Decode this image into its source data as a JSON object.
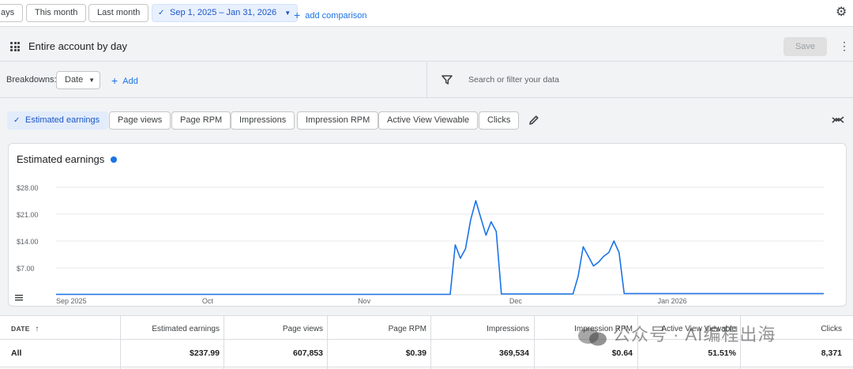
{
  "topbar": {
    "date_chips": [
      "ays",
      "This month",
      "Last month"
    ],
    "range_label": "Sep 1, 2025 – Jan 31, 2026",
    "add_comparison": "add comparison"
  },
  "header": {
    "title": "Entire account by day",
    "save_label": "Save"
  },
  "breakdowns": {
    "label": "Breakdowns:",
    "selected": "Date",
    "add_label": "Add",
    "search_placeholder": "Search or filter your data"
  },
  "metrics": [
    "Estimated earnings",
    "Page views",
    "Page RPM",
    "Impressions",
    "Impression RPM",
    "Active View Viewable",
    "Clicks"
  ],
  "colors": {
    "accent": "#1a73e8",
    "line": "#1a73e8"
  },
  "chart_data": {
    "type": "line",
    "title": "Estimated earnings",
    "y_ticks": [
      "$28.00",
      "$21.00",
      "$14.00",
      "$7.00"
    ],
    "ylim": [
      0,
      28
    ],
    "x_ticks": [
      "Sep 2025",
      "Oct",
      "Nov",
      "Dec",
      "Jan 2026"
    ],
    "x_tick_days": [
      0,
      30,
      61,
      91,
      122
    ],
    "x_range_days": [
      0,
      152
    ],
    "series": [
      {
        "values": [
          0.1,
          0.1,
          0.1,
          0.1,
          0.1,
          0.1,
          0.1,
          0.1,
          0.1,
          0.1,
          0.1,
          0.1,
          0.1,
          0.1,
          0.1,
          0.1,
          0.1,
          0.1,
          0.1,
          0.1,
          0.1,
          0.1,
          0.1,
          0.1,
          0.1,
          0.1,
          0.1,
          0.1,
          0.1,
          0.1,
          0.1,
          0.1,
          0.1,
          0.1,
          0.1,
          0.1,
          0.1,
          0.1,
          0.1,
          0.1,
          0.1,
          0.1,
          0.1,
          0.1,
          0.1,
          0.1,
          0.1,
          0.1,
          0.1,
          0.1,
          0.1,
          0.1,
          0.1,
          0.1,
          0.1,
          0.1,
          0.1,
          0.1,
          0.1,
          0.1,
          0.1,
          0.1,
          0.1,
          0.1,
          0.1,
          0.1,
          0.1,
          0.1,
          0.1,
          0.1,
          0.1,
          0.1,
          0.1,
          0.1,
          0.1,
          0.1,
          0.1,
          0.1,
          13.0,
          9.5,
          12.0,
          19.5,
          24.5,
          20.0,
          15.5,
          19.0,
          16.5,
          0.2,
          0.2,
          0.2,
          0.2,
          0.2,
          0.2,
          0.2,
          0.2,
          0.2,
          0.2,
          0.2,
          0.2,
          0.2,
          0.2,
          0.2,
          4.8,
          12.5,
          10.0,
          7.5,
          8.5,
          10.0,
          11.0,
          14.0,
          11.0,
          0.3,
          0.3,
          0.3,
          0.3,
          0.3,
          0.3,
          0.3,
          0.3,
          0.3,
          0.3,
          0.3,
          0.3,
          0.3,
          0.3,
          0.3,
          0.3,
          0.3,
          0.3,
          0.3,
          0.3,
          0.3,
          0.3,
          0.3,
          0.3,
          0.3,
          0.3,
          0.3,
          0.3,
          0.3,
          0.3,
          0.3,
          0.3,
          0.3,
          0.3,
          0.3,
          0.3,
          0.3,
          0.3,
          0.3,
          0.3
        ]
      }
    ]
  },
  "table": {
    "headers": [
      "DATE",
      "Estimated earnings",
      "Page views",
      "Page RPM",
      "Impressions",
      "Impression RPM",
      "Active View Viewable",
      "Clicks"
    ],
    "row_all": [
      "All",
      "$237.99",
      "607,853",
      "$0.39",
      "369,534",
      "$0.64",
      "51.51%",
      "8,371"
    ]
  },
  "watermark": "公众号 · AI编程出海"
}
